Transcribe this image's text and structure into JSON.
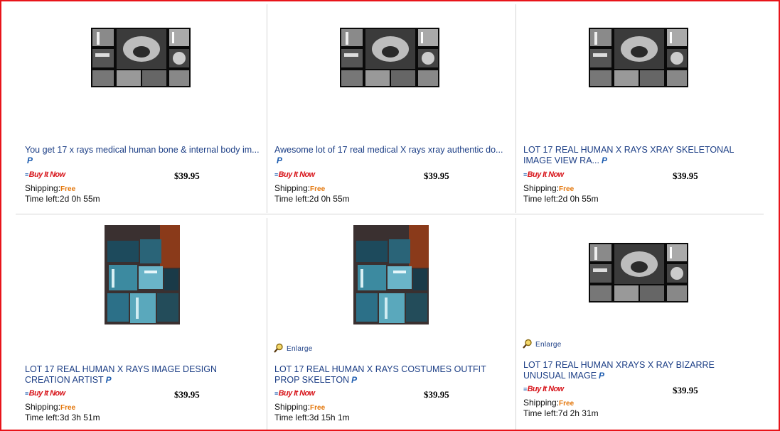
{
  "badge": {
    "buy_it_now": "Buy It Now",
    "buy_it_now_mark": "≡",
    "paypal_mark": "P"
  },
  "labels": {
    "shipping": "Shipping:",
    "time_left": "Time left:",
    "enlarge": "Enlarge"
  },
  "colors": {
    "frame": "#e8141a",
    "title": "#1d3f86",
    "free": "#e3760a",
    "buy_it_now": "#d7141a"
  },
  "listings": [
    {
      "title": "You get 17 x rays medical human bone & internal body im...",
      "paypal": true,
      "price": "$39.95",
      "shipping": "Free",
      "time_left": "2d 0h 55m",
      "image": "xray-collage",
      "enlarge": false
    },
    {
      "title": "Awesome lot of 17 real medical X rays xray authentic do...",
      "paypal": true,
      "price": "$39.95",
      "shipping": "Free",
      "time_left": "2d 0h 55m",
      "image": "xray-collage",
      "enlarge": false
    },
    {
      "title": "LOT 17 REAL HUMAN X RAYS XRAY SKELETONAL IMAGE VIEW RA...",
      "paypal": true,
      "price": "$39.95",
      "shipping": "Free",
      "time_left": "2d 0h 55m",
      "image": "xray-collage",
      "enlarge": false
    },
    {
      "title": "LOT 17 REAL HUMAN X RAYS IMAGE DESIGN CREATION ARTIST",
      "paypal": true,
      "price": "$39.95",
      "shipping": "Free",
      "time_left": "3d 3h 51m",
      "image": "xray-photo",
      "enlarge": false
    },
    {
      "title": "LOT 17 REAL HUMAN X RAYS COSTUMES OUTFIT PROP SKELETON",
      "paypal": true,
      "price": "$39.95",
      "shipping": "Free",
      "time_left": "3d 15h 1m",
      "image": "xray-photo",
      "enlarge": true
    },
    {
      "title": "LOT 17 REAL HUMAN XRAYS X RAY BIZARRE UNUSUAL IMAGE",
      "paypal": true,
      "price": "$39.95",
      "shipping": "Free",
      "time_left": "7d 2h 31m",
      "image": "xray-collage",
      "enlarge": true
    }
  ]
}
